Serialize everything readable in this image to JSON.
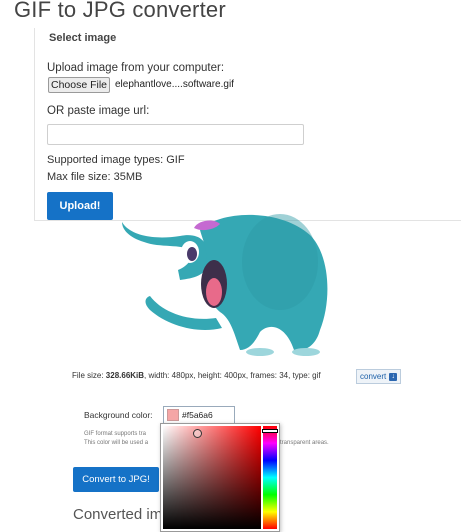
{
  "page": {
    "title": "GIF to JPG converter"
  },
  "upload": {
    "section_label": "Select image",
    "upload_label": "Upload image from your computer:",
    "choose_file_label": "Choose File",
    "file_name": "elephantlove....software.gif",
    "url_label": "OR paste image url:",
    "url_value": "",
    "supported_types": "Supported image types: GIF",
    "max_size": "Max file size: 35MB",
    "upload_button": "Upload!"
  },
  "file_info": {
    "size_label": "File size:",
    "size_value": "328.66KiB",
    "details": ", width: 480px, height: 400px, frames: 34, type: gif",
    "convert_label": "convert",
    "convert_icon": "download-icon"
  },
  "options": {
    "bg_label": "Background color:",
    "bg_value": "#f5a6a6",
    "note_line1": "GIF format supports tra",
    "note_line2": "This color will be used a",
    "note_line3": "transparent areas.",
    "convert_button": "Convert to JPG!",
    "converted_heading": "Converted im"
  },
  "colors": {
    "accent": "#1572c7",
    "swatch": "#f5a6a6",
    "elephant": "#35a8b4"
  }
}
